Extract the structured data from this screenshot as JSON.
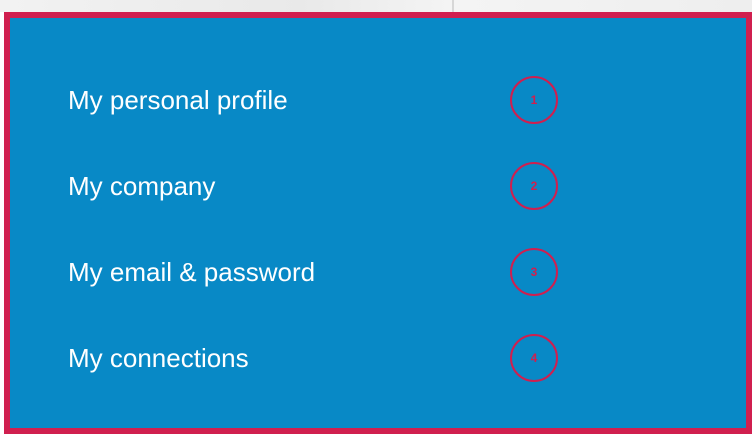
{
  "menu": {
    "items": [
      {
        "label": "My personal profile",
        "badge": "1"
      },
      {
        "label": "My company",
        "badge": "2"
      },
      {
        "label": "My email & password",
        "badge": "3"
      },
      {
        "label": "My connections",
        "badge": "4"
      }
    ]
  },
  "colors": {
    "panel_background": "#0889c6",
    "border_accent": "#d01f4f",
    "label_text": "#ffffff",
    "badge_text": "#d01f4f"
  }
}
